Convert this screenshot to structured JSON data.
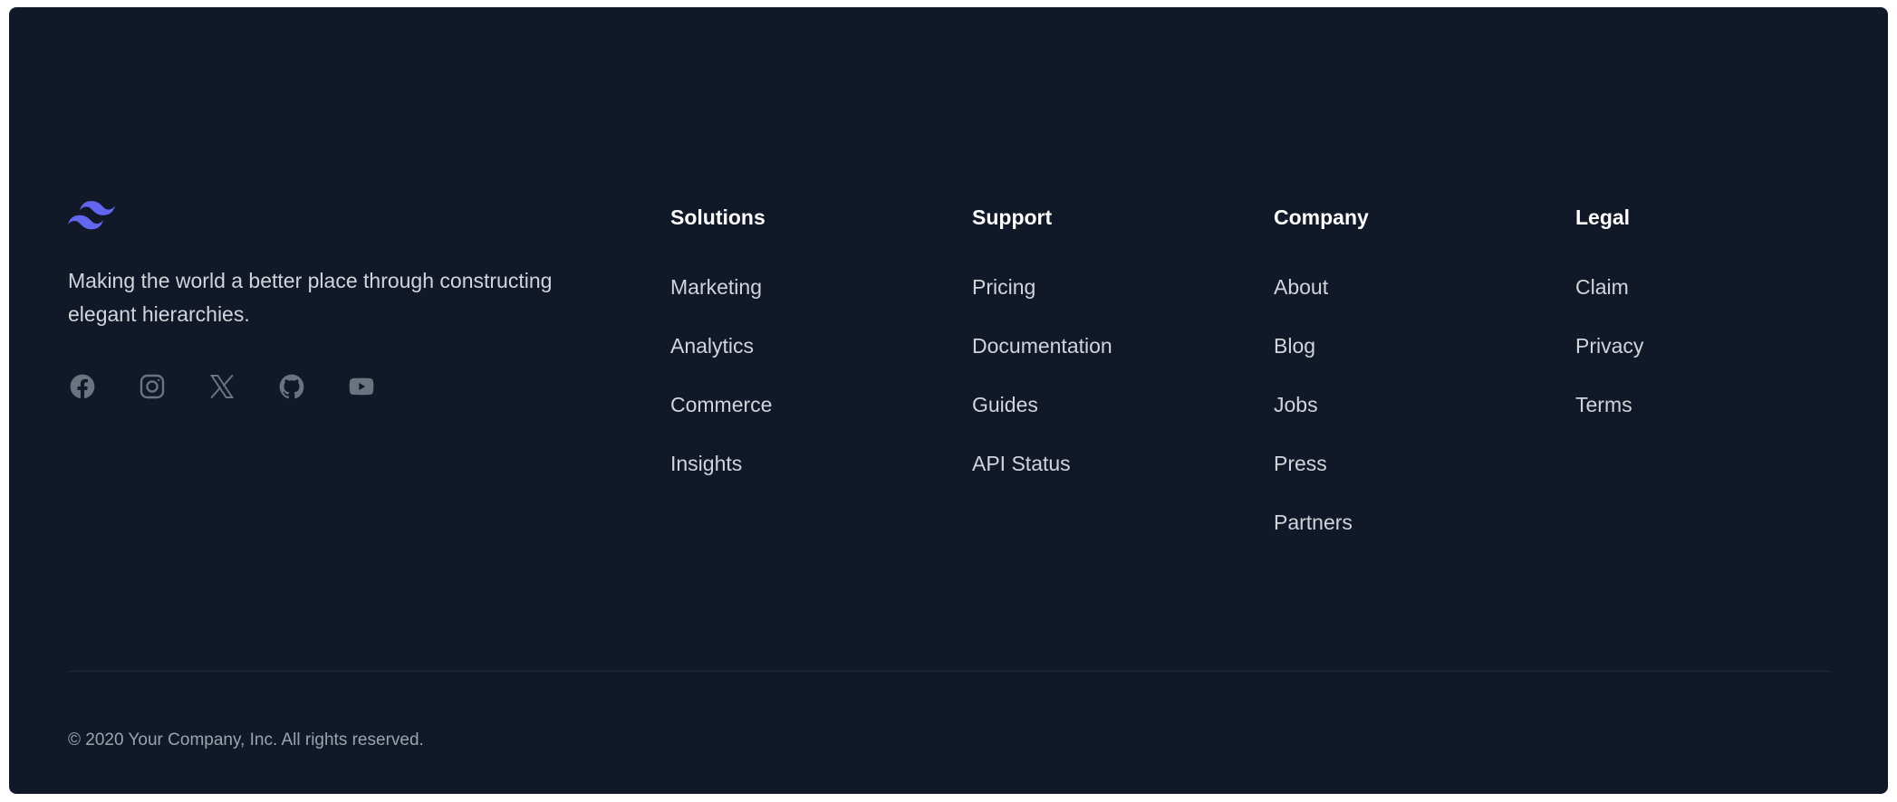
{
  "brand": {
    "logo_icon": "tailwind-waves-icon",
    "logo_color": "#6366f1",
    "tagline": "Making the world a better place through constructing elegant hierarchies."
  },
  "socials": [
    {
      "name": "Facebook",
      "icon": "facebook-icon"
    },
    {
      "name": "Instagram",
      "icon": "instagram-icon"
    },
    {
      "name": "X",
      "icon": "x-icon"
    },
    {
      "name": "GitHub",
      "icon": "github-icon"
    },
    {
      "name": "YouTube",
      "icon": "youtube-icon"
    }
  ],
  "columns": [
    {
      "heading": "Solutions",
      "links": [
        "Marketing",
        "Analytics",
        "Commerce",
        "Insights"
      ]
    },
    {
      "heading": "Support",
      "links": [
        "Pricing",
        "Documentation",
        "Guides",
        "API Status"
      ]
    },
    {
      "heading": "Company",
      "links": [
        "About",
        "Blog",
        "Jobs",
        "Press",
        "Partners"
      ]
    },
    {
      "heading": "Legal",
      "links": [
        "Claim",
        "Privacy",
        "Terms"
      ]
    }
  ],
  "copyright": "© 2020 Your Company, Inc. All rights reserved.",
  "colors": {
    "background": "#111827",
    "heading": "#ffffff",
    "link": "#d1d5db",
    "muted": "#9ca3af",
    "icon": "#6b7280",
    "divider": "#1f2937",
    "accent": "#6366f1"
  }
}
